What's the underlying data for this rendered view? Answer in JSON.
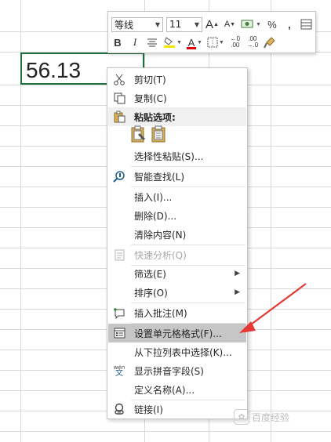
{
  "cell": {
    "value": "56.13"
  },
  "toolbar": {
    "font_name": "等线",
    "font_size": "11",
    "grow_font": "A",
    "shrink_font": "A",
    "percent": "%",
    "comma": ",",
    "bold": "B",
    "italic": "I",
    "font_color": "A",
    "dec_inc": ".00",
    "dec_dec": ".00"
  },
  "menu": {
    "items": [
      {
        "label": "剪切(T)",
        "icon": "cut-icon"
      },
      {
        "label": "复制(C)",
        "icon": "copy-icon"
      },
      {
        "label": "粘贴选项:",
        "icon": "paste-icon"
      },
      {
        "label": "选择性粘贴(S)..."
      },
      {
        "label": "智能查找(L)",
        "icon": "smart-lookup-icon"
      },
      {
        "label": "插入(I)..."
      },
      {
        "label": "删除(D)..."
      },
      {
        "label": "清除内容(N)"
      },
      {
        "label": "快速分析(Q)",
        "icon": "quick-analysis-icon"
      },
      {
        "label": "筛选(E)"
      },
      {
        "label": "排序(O)"
      },
      {
        "label": "插入批注(M)",
        "icon": "insert-comment-icon"
      },
      {
        "label": "设置单元格格式(F)...",
        "icon": "format-cells-icon"
      },
      {
        "label": "从下拉列表中选择(K)..."
      },
      {
        "label": "显示拼音字段(S)",
        "icon": "phonetic-icon"
      },
      {
        "label": "定义名称(A)..."
      },
      {
        "label": "链接(I)",
        "icon": "link-icon"
      }
    ],
    "paste_options": [
      "paste-keep-format-icon",
      "paste-values-icon"
    ]
  },
  "phonetic_icon_text": "wén",
  "phonetic_icon_char": "文",
  "watermark": {
    "text": "百度经验"
  }
}
